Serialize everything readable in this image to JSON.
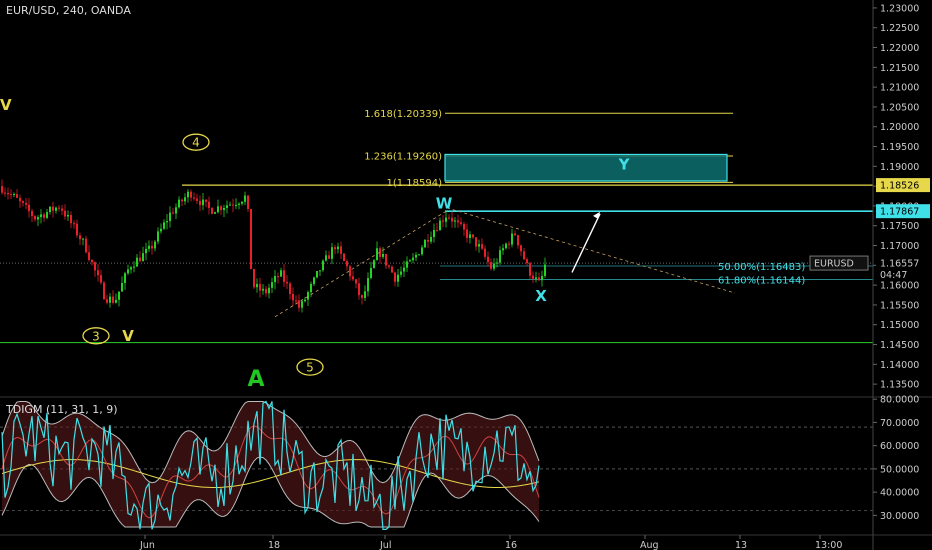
{
  "header": {
    "symbol_title": "EUR/USD, 240, OANDA"
  },
  "indicator": {
    "title": "TDIGM (11, 31, 1, 9)"
  },
  "colors": {
    "background": "#000000",
    "up_candle": "#26d226",
    "down_candle": "#e8202a",
    "cyan": "#3fe0e8",
    "yellow": "#e6d84a",
    "green_line": "#22b822",
    "axis_text": "#cccccc"
  },
  "chart_data": {
    "type": "candlestick",
    "y_axis_labels": [
      "1.23000",
      "1.22500",
      "1.22000",
      "1.21500",
      "1.21000",
      "1.20500",
      "1.20000",
      "1.19500",
      "1.19000",
      "1.18500",
      "1.18000",
      "1.17500",
      "1.17000",
      "1.16500",
      "1.16000",
      "1.15500",
      "1.15000",
      "1.14500",
      "1.14000",
      "1.13500"
    ],
    "ylim": [
      1.132,
      1.232
    ],
    "x_axis_labels": [
      "Jun",
      "18",
      "Jul",
      "16",
      "Aug",
      "13",
      "13:00"
    ],
    "price_tags": [
      {
        "label": "1.18526",
        "value": 1.18526,
        "style": "yellow"
      },
      {
        "label": "1.17867",
        "value": 1.17867,
        "style": "cyan"
      },
      {
        "label": "EURUSD",
        "value": 1.16557,
        "style": "dark"
      },
      {
        "label": "1.16557",
        "value": 1.16557,
        "style": "plain"
      },
      {
        "label": "04:47",
        "value": 1.1627,
        "style": "plain"
      }
    ],
    "fib_levels": [
      {
        "label": "1.618(1.20339)",
        "value": 1.20339
      },
      {
        "label": "1.236(1.19260)",
        "value": 1.1926
      },
      {
        "label": "1(1.18594)",
        "value": 1.18594
      }
    ],
    "retracements": [
      {
        "label": "50.00%(1.16483)",
        "value": 1.16483
      },
      {
        "label": "61.80%(1.16144)",
        "value": 1.16144
      }
    ],
    "horizontal_lines": [
      {
        "value": 1.18526,
        "color": "yellow"
      },
      {
        "value": 1.17867,
        "color": "cyan"
      },
      {
        "value": 1.1455,
        "color": "green"
      }
    ],
    "wave_labels": [
      {
        "text": "V",
        "style": "yellow",
        "value": 1.2055,
        "pos": "left-edge"
      },
      {
        "text": "4",
        "style": "circle",
        "value": 1.1961
      },
      {
        "text": "3",
        "style": "circle",
        "value": 1.1472
      },
      {
        "text": "V",
        "style": "yellow",
        "value": 1.1472
      },
      {
        "text": "A",
        "style": "green",
        "value": 1.1363
      },
      {
        "text": "5",
        "style": "circle",
        "value": 1.1393
      },
      {
        "text": "W",
        "style": "cyan",
        "value": 1.1806
      },
      {
        "text": "X",
        "style": "cyan",
        "value": 1.1573
      },
      {
        "text": "Y",
        "style": "cyan",
        "value": 1.1904
      }
    ],
    "target_zone": {
      "top": 1.193,
      "bottom": 1.1863
    },
    "indicator": {
      "name": "TDIGM (11, 31, 1, 9)",
      "y_axis_labels": [
        "80.0000",
        "70.0000",
        "60.0000",
        "50.0000",
        "40.0000",
        "30.0000"
      ],
      "ylim": [
        22,
        80.5
      ],
      "levels": [
        68,
        50,
        32
      ]
    }
  }
}
